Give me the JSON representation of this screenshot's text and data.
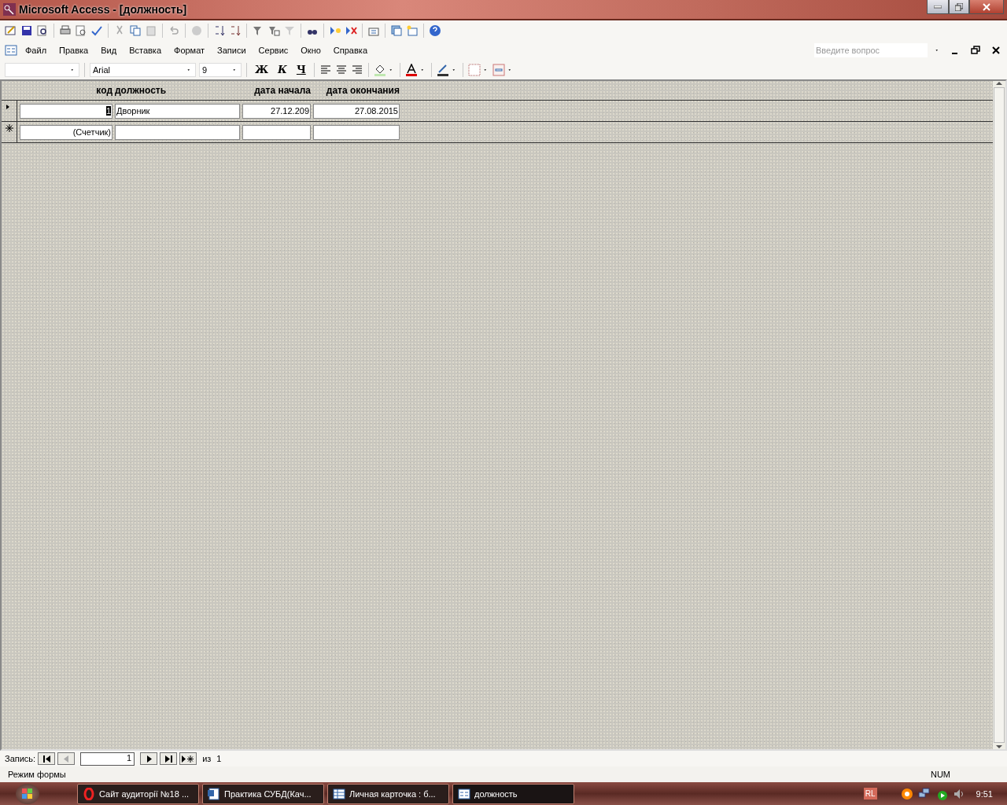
{
  "window": {
    "title": "Microsoft Access - [должность]"
  },
  "menu": [
    {
      "label": "Файл"
    },
    {
      "label": "Правка"
    },
    {
      "label": "Вид"
    },
    {
      "label": "Вставка"
    },
    {
      "label": "Формат"
    },
    {
      "label": "Записи"
    },
    {
      "label": "Сервис"
    },
    {
      "label": "Окно"
    },
    {
      "label": "Справка"
    }
  ],
  "help_search": {
    "placeholder": "Введите вопрос"
  },
  "format_toolbar": {
    "font": "Arial",
    "size": "9",
    "bold": "Ж",
    "italic": "К",
    "underline": "Ч"
  },
  "form": {
    "columns": [
      {
        "label": "код"
      },
      {
        "label": "должность"
      },
      {
        "label": "дата начала"
      },
      {
        "label": "дата окончания"
      }
    ],
    "rows": [
      {
        "kind": "current",
        "cells": [
          {
            "text": "1",
            "highlighted": true
          },
          {
            "text": "Дворник",
            "highlighted": false
          },
          {
            "text": "27.12.209",
            "highlighted": false
          },
          {
            "text": "27.08.2015",
            "highlighted": false
          }
        ]
      },
      {
        "kind": "new",
        "cells": [
          {
            "text": "(Счетчик)",
            "highlighted": false
          }
        ]
      }
    ]
  },
  "navigation": {
    "label": "Запись:",
    "current": "1",
    "of_label": "из",
    "total": "1"
  },
  "status_bar": {
    "mode": "Режим формы",
    "indicator": "NUM"
  },
  "taskbar": {
    "items": [
      {
        "label": "Сайт аудиторії №18 ...",
        "kind": "browser",
        "selected": false
      },
      {
        "label": "Практика СУБД(Кач...",
        "kind": "word",
        "selected": false
      },
      {
        "label": "Личная карточка : б...",
        "kind": "table",
        "selected": false
      },
      {
        "label": "должность",
        "kind": "form",
        "selected": true
      }
    ],
    "language": "RL",
    "time": "9:51"
  }
}
